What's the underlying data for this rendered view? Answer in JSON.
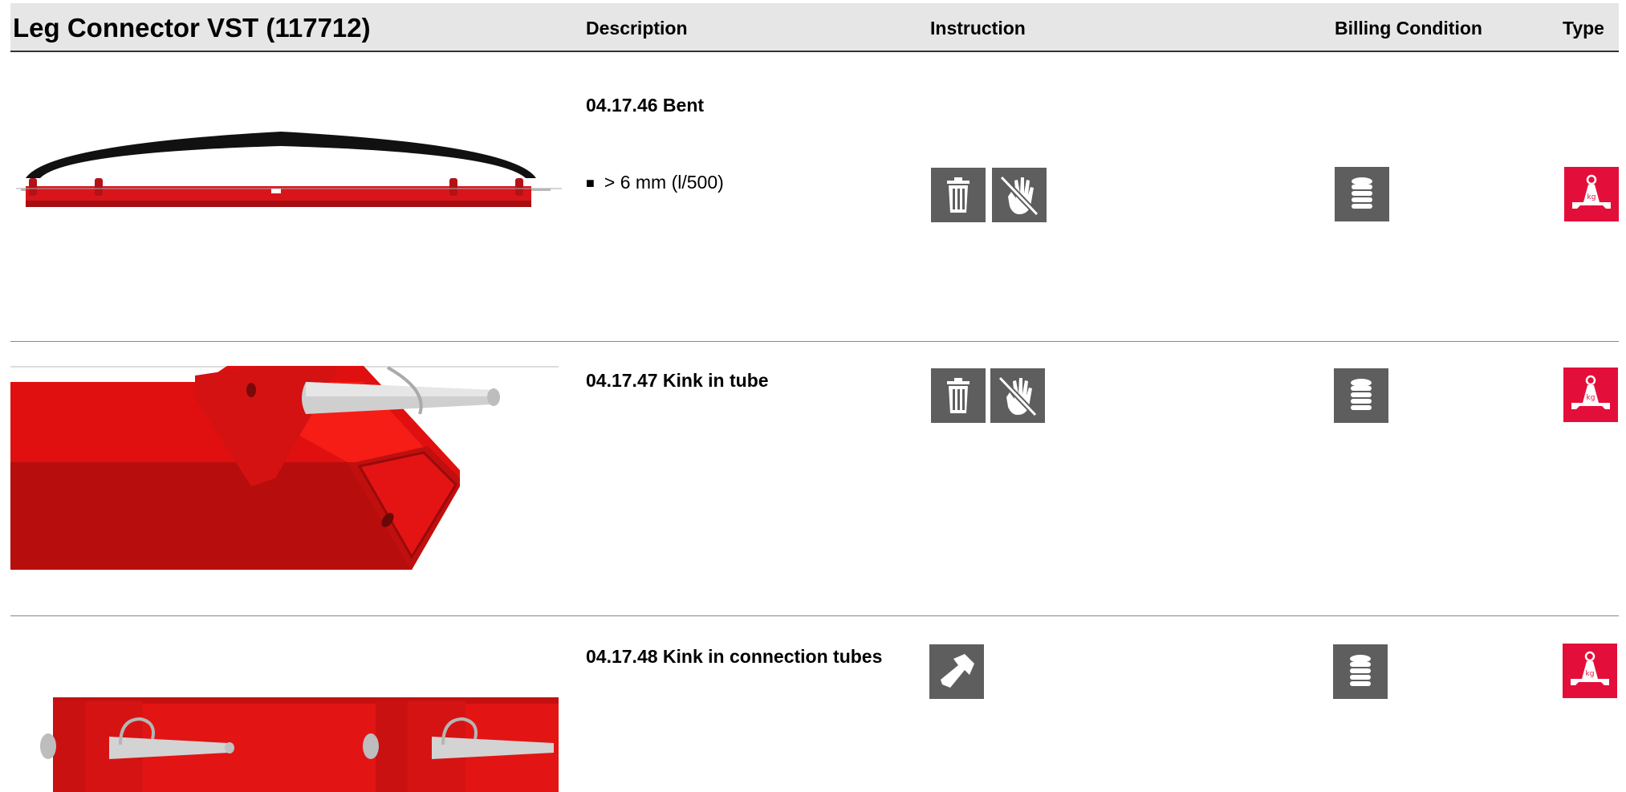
{
  "header": {
    "title": "Leg Connector VST (117712)",
    "col_description": "Description",
    "col_instruction": "Instruction",
    "col_billing": "Billing Condition",
    "col_type": "Type"
  },
  "rows": [
    {
      "code": "04.17.46 Bent",
      "bullets": [
        "> 6 mm (l/500)"
      ],
      "instruction_icons": [
        "scrap-bin-icon",
        "no-repair-hand-icon"
      ],
      "billing_icon": "coin-stack-icon",
      "type_icon": "weight-kg-icon",
      "image": "bent-leg-connector-illustration"
    },
    {
      "code": "04.17.47 Kink in tube",
      "bullets": [],
      "instruction_icons": [
        "scrap-bin-icon",
        "no-repair-hand-icon"
      ],
      "billing_icon": "coin-stack-icon",
      "type_icon": "weight-kg-icon",
      "image": "kinked-tube-illustration"
    },
    {
      "code": "04.17.48 Kink in connection tubes",
      "bullets": [],
      "instruction_icons": [
        "hammer-icon"
      ],
      "billing_icon": "coin-stack-icon",
      "type_icon": "weight-kg-icon",
      "image": "connection-tubes-illustration"
    }
  ],
  "colors": {
    "header_bg": "#e6e6e6",
    "icon_grey": "#5e5e5e",
    "type_red": "#e30f3a",
    "part_red": "#e11a12"
  }
}
